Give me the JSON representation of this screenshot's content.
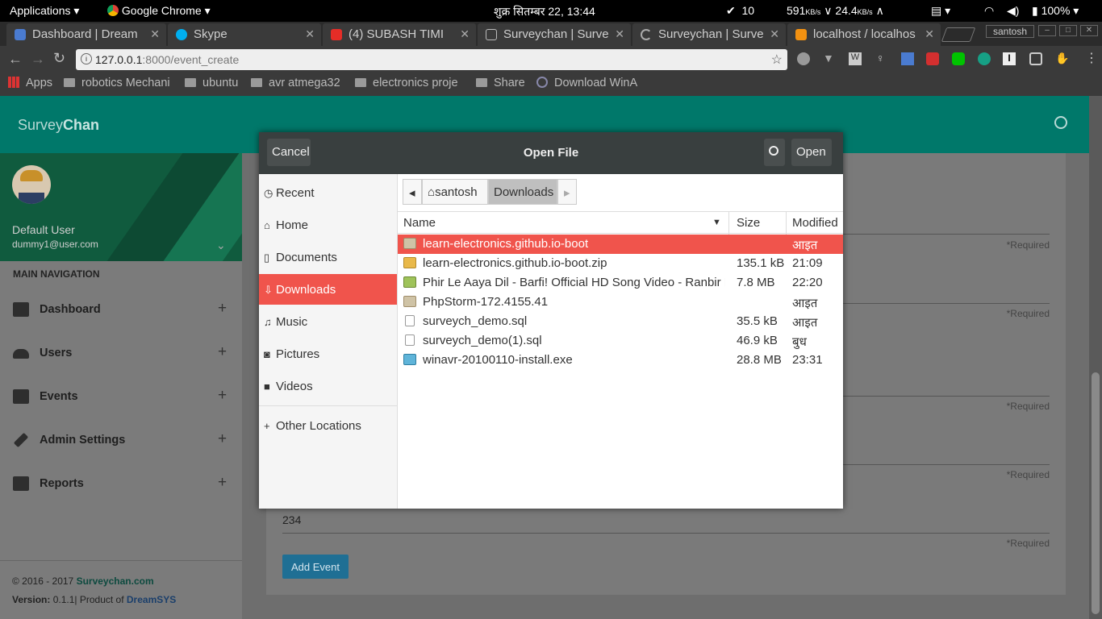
{
  "os_bar": {
    "applications": "Applications",
    "app_name": "Google Chrome",
    "clock": "शुक्र सितम्बर 22, 13:44",
    "tasks_count": "10",
    "net_down": "591",
    "net_down_unit": "KB/s",
    "net_up": "24.4",
    "net_up_unit": "KB/s",
    "battery": "100%"
  },
  "tabs": [
    {
      "title": "Dashboard | Dream",
      "favicon_color": "#4a7bd0"
    },
    {
      "title": "Skype",
      "favicon_color": "#00aff0"
    },
    {
      "title": "(4) SUBASH TIMI",
      "favicon_color": "#e52d27"
    },
    {
      "title": "Surveychan | Surve",
      "favicon_color": "#cfcfcf"
    },
    {
      "title": "Surveychan | Surve",
      "favicon_color": "#cfcfcf"
    },
    {
      "title": "localhost / localhos",
      "favicon_color": "#f29111"
    }
  ],
  "profile_name": "santosh",
  "address": {
    "host": "127.0.0.1",
    "rest": ":8000/event_create"
  },
  "bookmarks": [
    {
      "label": "Apps"
    },
    {
      "label": "robotics Mechani"
    },
    {
      "label": "ubuntu"
    },
    {
      "label": "avr atmega32"
    },
    {
      "label": "electronics proje"
    },
    {
      "label": "Share"
    },
    {
      "label": "Download WinA"
    }
  ],
  "app": {
    "brand_a": "Survey",
    "brand_b": "Chan",
    "user_name": "Default User",
    "user_email": "dummy1@user.com",
    "nav_heading": "MAIN NAVIGATION",
    "nav": [
      {
        "label": "Dashboard"
      },
      {
        "label": "Users"
      },
      {
        "label": "Events"
      },
      {
        "label": "Admin Settings"
      },
      {
        "label": "Reports"
      }
    ],
    "copyright_prefix": "© 2016 - 2017",
    "copyright_link": "Surveychan.com",
    "version_label": "Version:",
    "version_value": "0.1.1| Product of",
    "version_link": "DreamSYS"
  },
  "form": {
    "required": "*Required",
    "number_value": "234",
    "submit": "Add Event"
  },
  "dialog": {
    "cancel": "Cancel",
    "title": "Open File",
    "open": "Open",
    "places": [
      {
        "label": "Recent",
        "icon": "clock-icon"
      },
      {
        "label": "Home",
        "icon": "home-icon"
      },
      {
        "label": "Documents",
        "icon": "document-icon"
      },
      {
        "label": "Downloads",
        "icon": "download-icon"
      },
      {
        "label": "Music",
        "icon": "music-icon"
      },
      {
        "label": "Pictures",
        "icon": "camera-icon"
      },
      {
        "label": "Videos",
        "icon": "video-icon"
      },
      {
        "label": "Other Locations",
        "icon": "plus-icon"
      }
    ],
    "crumbs": [
      "santosh",
      "Downloads"
    ],
    "col_name": "Name",
    "col_size": "Size",
    "col_modified": "Modified",
    "files": [
      {
        "name": "learn-electronics.github.io-boot",
        "size": "",
        "modified": "आइत",
        "icon": "folder-icon"
      },
      {
        "name": "learn-electronics.github.io-boot.zip",
        "size": "135.1 kB",
        "modified": "21:09",
        "icon": "archive-icon"
      },
      {
        "name": "Phir Le Aaya Dil - Barfi! Official HD Song Video - Ranbir K...",
        "size": "7.8 MB",
        "modified": "22:20",
        "icon": "audio-icon"
      },
      {
        "name": "PhpStorm-172.4155.41",
        "size": "",
        "modified": "आइत",
        "icon": "folder-icon"
      },
      {
        "name": "surveych_demo.sql",
        "size": "35.5 kB",
        "modified": "आइत",
        "icon": "text-file-icon"
      },
      {
        "name": "surveych_demo(1).sql",
        "size": "46.9 kB",
        "modified": "बुध",
        "icon": "text-file-icon"
      },
      {
        "name": "winavr-20100110-install.exe",
        "size": "28.8 MB",
        "modified": "23:31",
        "icon": "executable-icon"
      }
    ]
  }
}
